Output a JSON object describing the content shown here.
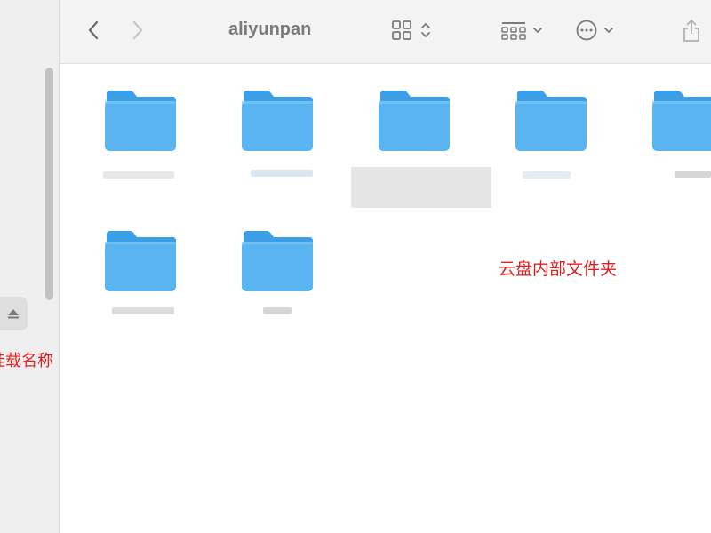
{
  "window": {
    "title": "aliyunpan"
  },
  "sidebar": {
    "mount_label": "挂载名称"
  },
  "main": {
    "annotation": "云盘内部文件夹",
    "folders": [
      {
        "name": ""
      },
      {
        "name": ""
      },
      {
        "name": ""
      },
      {
        "name": ""
      },
      {
        "name": ""
      },
      {
        "name": ""
      },
      {
        "name": ""
      }
    ]
  },
  "colors": {
    "folder": "#5ab4f0",
    "folder_tab": "#3a9fe6",
    "annotation": "#e02020"
  }
}
